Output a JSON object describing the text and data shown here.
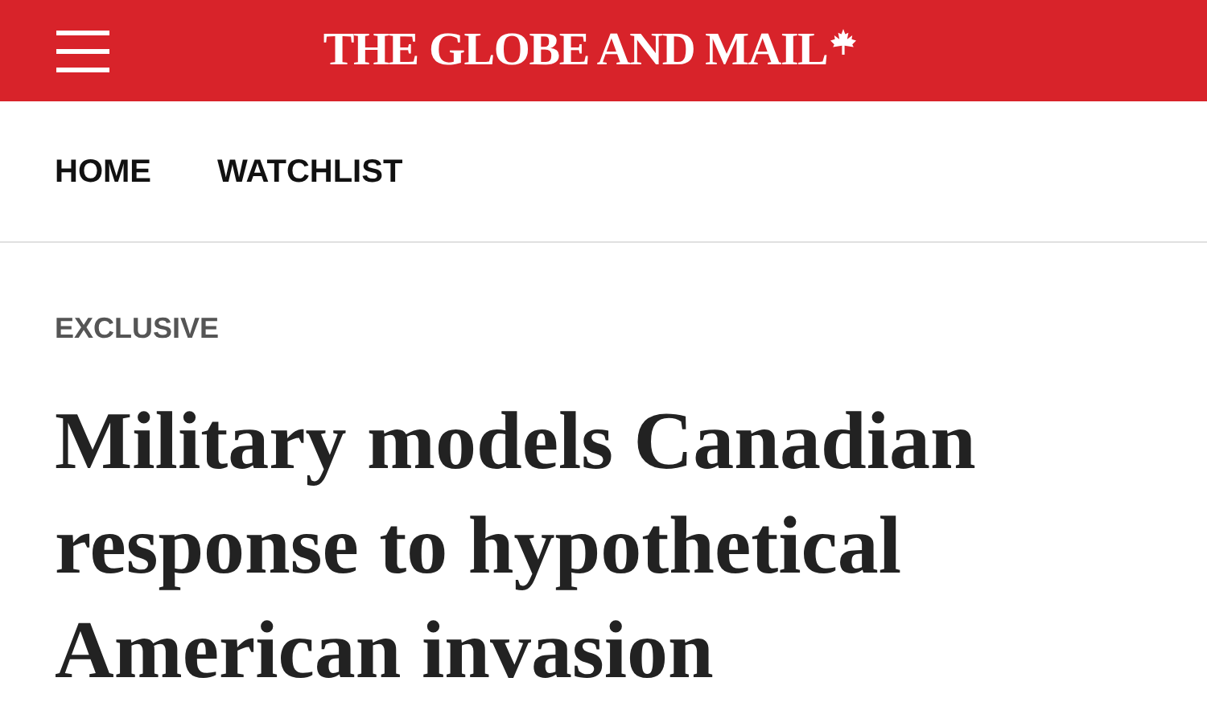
{
  "header": {
    "title": "THE GLOBE AND MAIL"
  },
  "nav": {
    "items": [
      {
        "label": "HOME"
      },
      {
        "label": "WATCHLIST"
      }
    ]
  },
  "article": {
    "label": "EXCLUSIVE",
    "headline": "Military models Canadian response to hypothetical American invasion"
  }
}
